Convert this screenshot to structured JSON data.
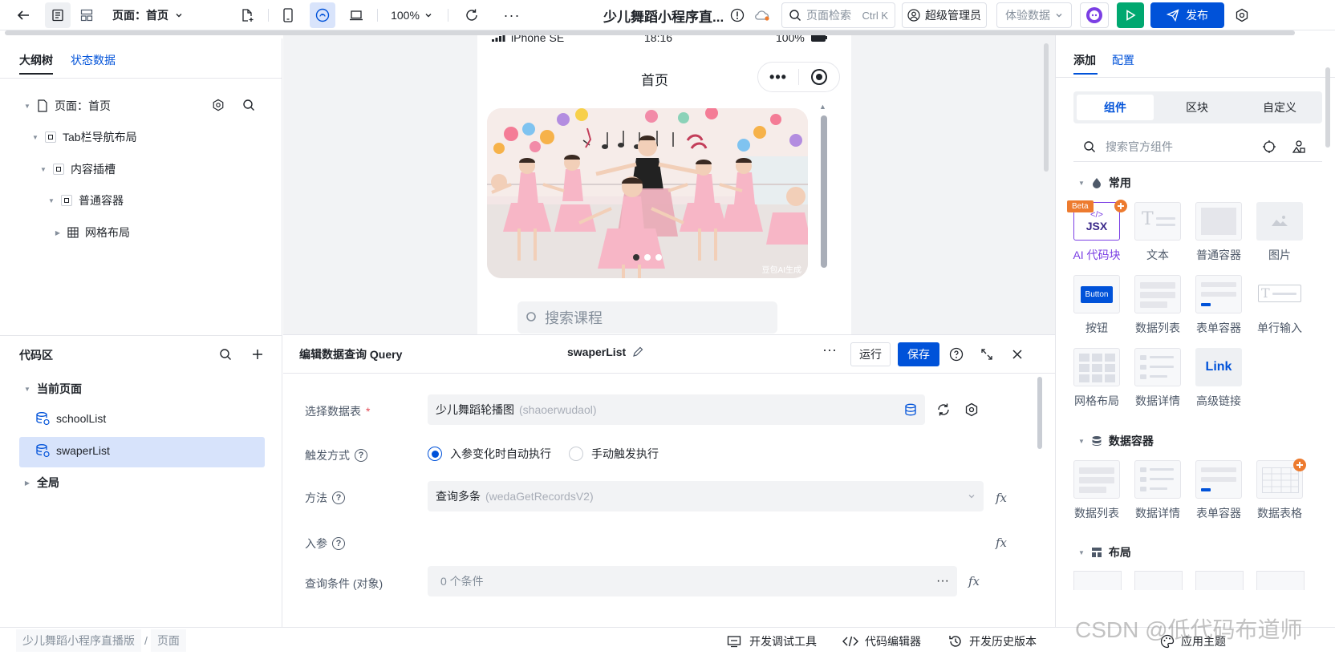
{
  "topbar": {
    "page_selector": "页面：首页",
    "zoom": "100%",
    "app_title": "少儿舞蹈小程序直...",
    "search_placeholder": "页面检索",
    "search_shortcut": "Ctrl K",
    "user_role": "超级管理员",
    "data_env": "体验数据",
    "publish": "发布"
  },
  "outline": {
    "tabs": [
      "大纲树",
      "状态数据"
    ],
    "nodes": [
      {
        "label": "页面：首页"
      },
      {
        "label": "Tab栏导航布局"
      },
      {
        "label": "内容插槽"
      },
      {
        "label": "普通容器"
      },
      {
        "label": "网格布局"
      }
    ]
  },
  "code_area": {
    "title": "代码区",
    "group_current": "当前页面",
    "items": [
      "schoolList",
      "swaperList"
    ],
    "group_global": "全局"
  },
  "phone": {
    "carrier": "iPhone SE",
    "time": "18:16",
    "battery": "100%",
    "nav_title": "首页",
    "watermark": "豆包AI生成",
    "search_hint": "搜索课程"
  },
  "query_editor": {
    "title": "编辑数据查询 Query",
    "query_name": "swaperList",
    "run": "运行",
    "save": "保存",
    "table_label": "选择数据表",
    "table_value": "少儿舞蹈轮播图",
    "table_code": "(shaoerwudaol)",
    "trigger_label": "触发方式",
    "trigger_auto": "入参变化时自动执行",
    "trigger_manual": "手动触发执行",
    "method_label": "方法",
    "method_value": "查询多条",
    "method_code": "(wedaGetRecordsV2)",
    "params_label": "入参",
    "cond_label": "查询条件 (对象)",
    "cond_value": "0 个条件"
  },
  "right_panel": {
    "tabs": [
      "添加",
      "配置"
    ],
    "segments": [
      "组件",
      "区块",
      "自定义"
    ],
    "search_placeholder": "搜索官方组件",
    "sections": [
      "常用",
      "数据容器",
      "布局"
    ],
    "common": [
      {
        "label": "AI 代码块",
        "badge": "Beta",
        "thumb": "JSX"
      },
      {
        "label": "文本"
      },
      {
        "label": "普通容器"
      },
      {
        "label": "图片"
      },
      {
        "label": "按钮",
        "thumb": "Button"
      },
      {
        "label": "数据列表"
      },
      {
        "label": "表单容器"
      },
      {
        "label": "单行输入"
      },
      {
        "label": "网格布局"
      },
      {
        "label": "数据详情"
      },
      {
        "label": "高级链接",
        "thumb": "Link"
      }
    ],
    "data_containers": [
      {
        "label": "数据列表"
      },
      {
        "label": "数据详情"
      },
      {
        "label": "表单容器"
      },
      {
        "label": "数据表格"
      }
    ]
  },
  "bottombar": {
    "breadcrumb": [
      "少儿舞蹈小程序直播版",
      "页面"
    ],
    "devtools": "开发调试工具",
    "code_editor": "代码编辑器",
    "history": "开发历史版本",
    "theme": "应用主题",
    "watermark": "CSDN @低代码布道师"
  },
  "colors": {
    "primary": "#0052d9",
    "selected_bg": "#d7e3fb",
    "run_green": "#00a870",
    "ai_purple": "#7b3fe4",
    "beta_orange": "#ed7b2f"
  }
}
